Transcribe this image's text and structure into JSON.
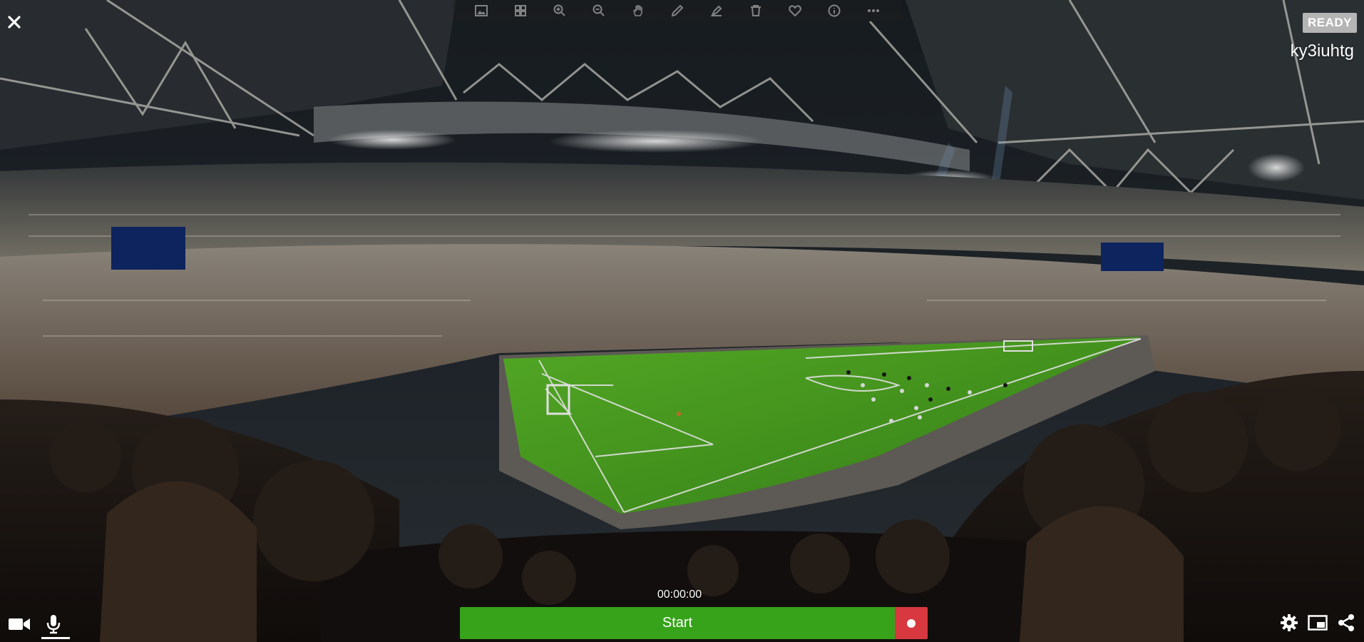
{
  "toolbar": {
    "icons": [
      "image-icon",
      "grid-icon",
      "zoom-in-icon",
      "zoom-out-icon",
      "hand-icon",
      "pencil-icon",
      "marker-icon",
      "trash-icon",
      "heart-icon",
      "info-icon",
      "more-icon"
    ]
  },
  "status": {
    "badge": "READY",
    "session_id": "ky3iuhtg"
  },
  "controls": {
    "timer": "00:00:00",
    "start_label": "Start",
    "colors": {
      "start": "#36a31b",
      "record": "#d8383f",
      "badge": "#b5b5b5"
    }
  },
  "bottom_left": {
    "icons": [
      "camera-icon",
      "microphone-icon"
    ]
  },
  "bottom_right": {
    "icons": [
      "gear-icon",
      "picture-in-picture-icon",
      "share-icon"
    ]
  }
}
